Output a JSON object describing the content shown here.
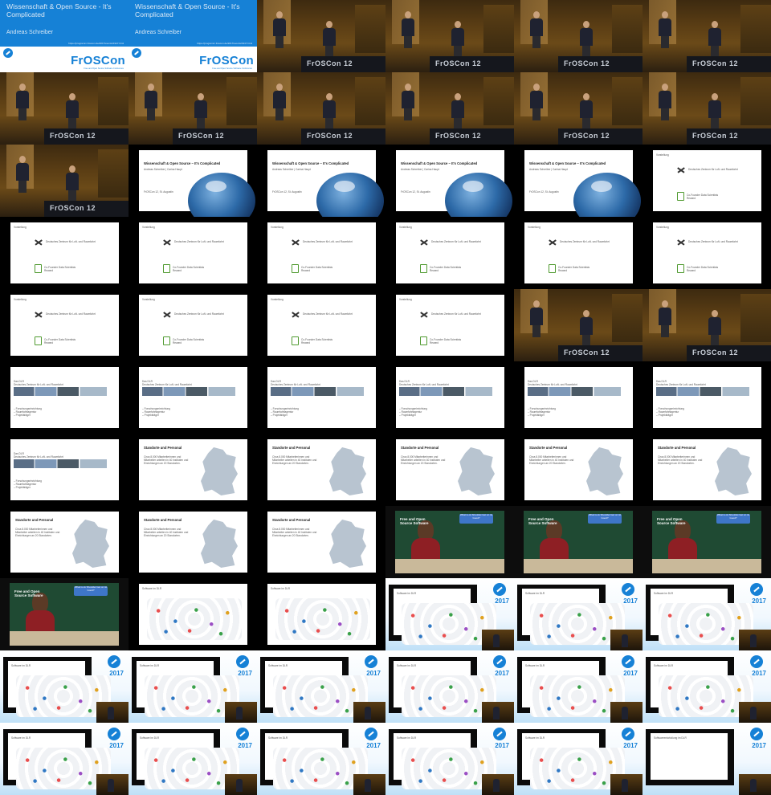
{
  "title_card": {
    "title": "Wissenschaft & Open Source - It's Complicated",
    "author": "Andreas Schreiber",
    "url": "https://programm.froscon.de/2017/events/1947.html",
    "logo": "FrOSCon",
    "tagline": "Free and Open Source Software Conference"
  },
  "stage": {
    "banner": "FrOSCon 12"
  },
  "slides": {
    "title_slide": {
      "title": "Wissenschaft & Open Source – It's Complicated",
      "authors": "Andreas Schreiber | Carina Haupt",
      "event": "FrOSCon 12, St. Augustin"
    },
    "presentation": {
      "heading": "Vorstellung",
      "org": "Deutsches Zentrum für Luft- und Raumfahrt",
      "product": "Co-Founder Data Scientists Reward"
    },
    "dlr": {
      "heading": "Das DLR",
      "subheading": "Deutsches Zentrum für Luft- und Raumfahrt",
      "bullets": [
        "Forschungseinrichtung",
        "Raumfahrtagentur",
        "Projektträger"
      ]
    },
    "locations": {
      "heading": "Standorte und Personal",
      "text": "Circa 8.000 Mitarbeiterinnen und Mitarbeiter arbeiten in 40 Instituten und Einrichtungen an 20 Standorten."
    },
    "rms": {
      "caption": "Free and Open Source Software",
      "bubble": "What is ok Shouldet Get on ist Good?"
    },
    "software": {
      "heading": "Software im DLR"
    },
    "last": {
      "heading": "Softwareentwicklung im DLR"
    }
  },
  "branding": {
    "year": "2017"
  },
  "tiles": [
    "title",
    "title",
    "stage",
    "stage",
    "stage",
    "stage",
    "stage",
    "stage",
    "stage",
    "stage",
    "stage",
    "stage",
    "stage",
    "dlr-title",
    "dlr-title",
    "dlr-title",
    "dlr-title",
    "presentation",
    "presentation",
    "presentation",
    "presentation",
    "presentation",
    "presentation",
    "presentation",
    "presentation",
    "presentation",
    "presentation",
    "presentation",
    "stage",
    "stage",
    "dlr",
    "dlr",
    "dlr",
    "dlr",
    "dlr",
    "dlr",
    "dlr",
    "locations",
    "locations",
    "locations",
    "locations",
    "locations",
    "locations",
    "locations",
    "locations-rms",
    "rms",
    "rms",
    "rms",
    "rms",
    "software",
    "software",
    "proj",
    "proj",
    "proj",
    "proj",
    "proj",
    "proj",
    "proj",
    "proj",
    "proj",
    "proj",
    "proj",
    "proj",
    "proj",
    "proj",
    "proj-last"
  ]
}
